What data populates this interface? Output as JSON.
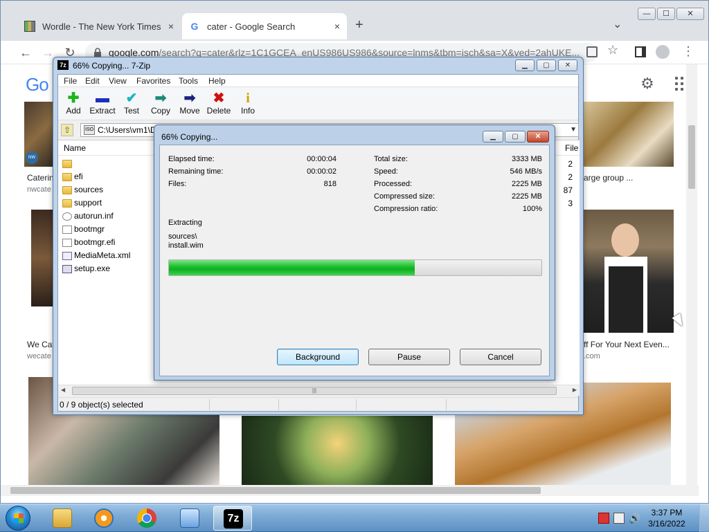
{
  "browser": {
    "tabs": [
      {
        "title": "Wordle - The New York Times",
        "favicon": "wordle-grid-icon",
        "close": "×"
      },
      {
        "title": "cater - Google Search",
        "favicon": "google-g-icon",
        "close": "×"
      }
    ],
    "new_tab": "+",
    "tab_overflow": "⌄",
    "window_controls": {
      "minimize": "—",
      "maximize": "☐",
      "close": "✕"
    },
    "nav": {
      "back": "←",
      "forward": "→",
      "reload": "↻"
    },
    "url_host": "google.com",
    "url_rest": "/search?q=cater&rlz=1C1GCEA_enUS986US986&source=lnms&tbm=isch&sa=X&ved=2ahUKE...",
    "toolbar_icons": [
      "share-icon",
      "star-icon",
      "side-panel-icon",
      "profile-icon",
      "menu-icon"
    ]
  },
  "google": {
    "logo": "Go",
    "results": [
      {
        "caption": "Caterin",
        "source": "nwcate"
      },
      {
        "caption": "arge group ...",
        "source": ""
      },
      {
        "caption": "We Cat",
        "source": "wecate"
      },
      {
        "caption": "ff For Your Next Even...",
        "source": ".com"
      }
    ],
    "small_badge": "NW CATER"
  },
  "zip_window": {
    "title": "66% Copying... 7-Zip",
    "icon_text": "7z",
    "menu": [
      "File",
      "Edit",
      "View",
      "Favorites",
      "Tools",
      "Help"
    ],
    "toolbar": [
      {
        "label": "Add",
        "glyph": "✚",
        "color": "#1db31d"
      },
      {
        "label": "Extract",
        "glyph": "▬",
        "color": "#1a2fbf"
      },
      {
        "label": "Test",
        "glyph": "✔",
        "color": "#19b6c4"
      },
      {
        "label": "Copy",
        "glyph": "➡",
        "color": "#1d8a7a"
      },
      {
        "label": "Move",
        "glyph": "➡",
        "color": "#1a237e"
      },
      {
        "label": "Delete",
        "glyph": "✖",
        "color": "#d01010"
      },
      {
        "label": "Info",
        "glyph": "i",
        "color": "#c8a800"
      }
    ],
    "address": "C:\\Users\\vm1\\D",
    "column_name": "Name",
    "column_right": "File",
    "files": [
      {
        "name": "",
        "type": "folder",
        "num": "2"
      },
      {
        "name": "efi",
        "type": "folder",
        "num": "2"
      },
      {
        "name": "sources",
        "type": "folder",
        "num": "87"
      },
      {
        "name": "support",
        "type": "folder",
        "num": "3"
      },
      {
        "name": "autorun.inf",
        "type": "gear",
        "num": ""
      },
      {
        "name": "bootmgr",
        "type": "doc",
        "num": ""
      },
      {
        "name": "bootmgr.efi",
        "type": "doc",
        "num": ""
      },
      {
        "name": "MediaMeta.xml",
        "type": "xml",
        "num": ""
      },
      {
        "name": "setup.exe",
        "type": "exe",
        "num": ""
      }
    ],
    "status": "0 / 9 object(s) selected"
  },
  "progress_dialog": {
    "title": "66% Copying...",
    "elapsed_label": "Elapsed time:",
    "elapsed": "00:00:04",
    "remaining_label": "Remaining time:",
    "remaining": "00:00:02",
    "files_label": "Files:",
    "files": "818",
    "total_label": "Total size:",
    "total": "3333 MB",
    "speed_label": "Speed:",
    "speed": "546 MB/s",
    "processed_label": "Processed:",
    "processed": "2225 MB",
    "compressed_label": "Compressed size:",
    "compressed": "2225 MB",
    "ratio_label": "Compression ratio:",
    "ratio": "100%",
    "operation": "Extracting",
    "path_line1": "sources\\",
    "path_line2": "install.wim",
    "progress_fraction": 0.66,
    "buttons": {
      "background": "Background",
      "pause": "Pause",
      "cancel": "Cancel"
    }
  },
  "taskbar": {
    "clock_time": "3:37 PM",
    "clock_date": "3/16/2022",
    "apps": [
      "explorer-icon",
      "media-player-icon",
      "chrome-icon",
      "control-panel-icon",
      "7zip-icon"
    ],
    "active_app_text": "7z"
  }
}
